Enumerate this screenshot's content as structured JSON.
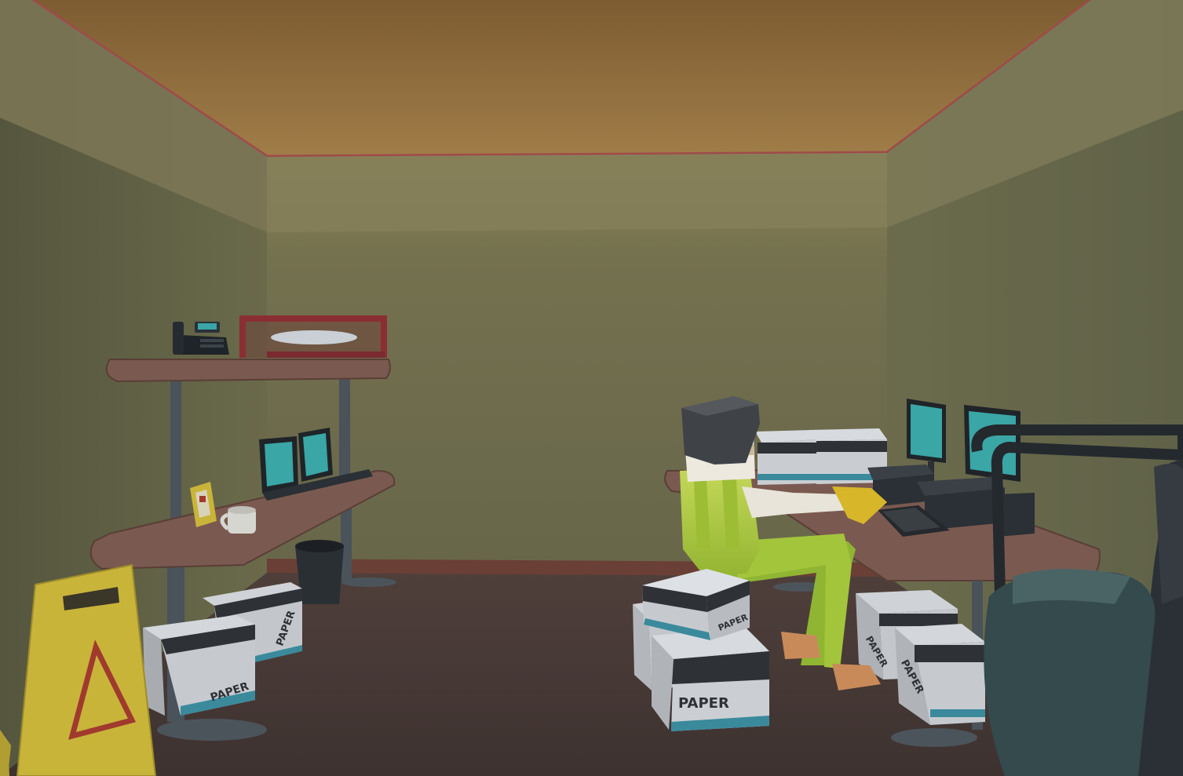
{
  "scene": {
    "title": "",
    "palette": {
      "ceiling": "#8f6a3c",
      "ceiling_trim": "#a04a4a",
      "wall_back": "#77734e",
      "wall_side": "#6b6a4a",
      "floor": "#4a3c39",
      "desk_top": "#7a5a50",
      "box_white": "#d7dbe0",
      "box_band": "#2e3236",
      "box_stripe": "#3a8a9c",
      "worker_vest": "#a8c63a",
      "worker_pants": "#9bc13a",
      "monitor_screen": "#3aa6a6",
      "sign_yellow": "#c9b43a",
      "sign_red": "#a03a2e"
    }
  },
  "boxes": {
    "label": "PAPER"
  },
  "props": [
    "desk-phone",
    "glass-display-case",
    "open-laptop",
    "photo-frame",
    "coffee-mug",
    "trash-bin",
    "wet-floor-sign",
    "twin-monitors",
    "keyboard",
    "office-chair",
    "office-worker"
  ]
}
